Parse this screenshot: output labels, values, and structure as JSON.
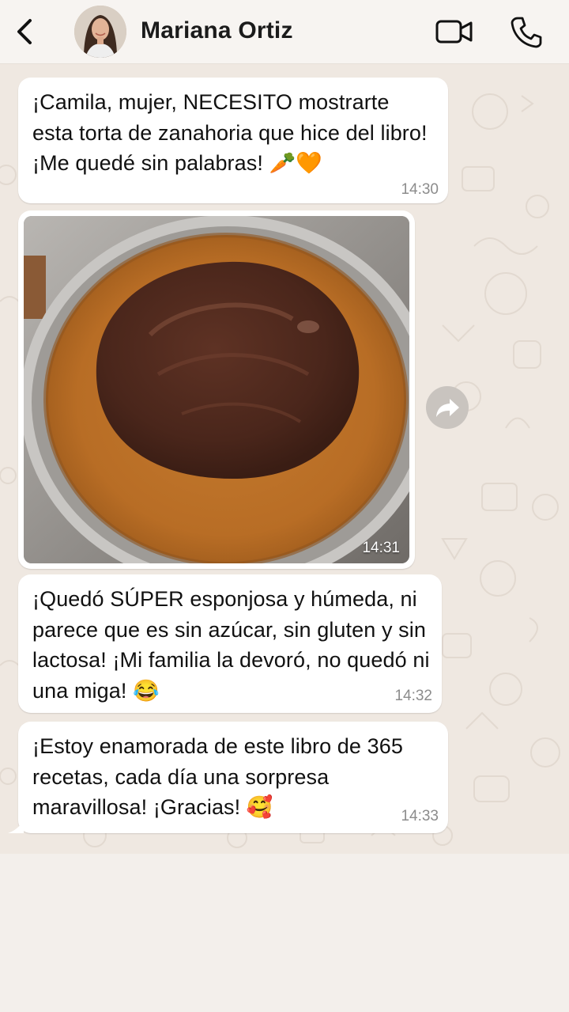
{
  "header": {
    "contact_name": "Mariana Ortiz",
    "icons": {
      "back": "chevron-left-icon",
      "video": "video-camera-icon",
      "call": "phone-icon"
    }
  },
  "messages": [
    {
      "type": "text",
      "text": "¡Camila, mujer, NECESITO mostrarte esta torta de zanahoria que hice del libro! ¡Me quedé sin palabras! 🥕🧡",
      "time": "14:30"
    },
    {
      "type": "image",
      "image_subject": "chocolate-topped carrot cake in a round pan",
      "time": "14:31"
    },
    {
      "type": "text",
      "text": "¡Quedó SÚPER esponjosa y húmeda, ni parece que es sin azúcar, sin gluten y sin lactosa! ¡Mi familia la devoró, no quedó ni una miga! 😂",
      "time": "14:32"
    },
    {
      "type": "text",
      "text": "¡Estoy enamorada de este libro de 365 recetas, cada día una sorpresa maravillosa! ¡Gracias! 🥰",
      "time": "14:33"
    }
  ],
  "colors": {
    "header_bg": "#f7f4f1",
    "chat_bg": "#efe8e1",
    "bubble_bg": "#ffffff",
    "time_text": "#8c8c8c"
  }
}
